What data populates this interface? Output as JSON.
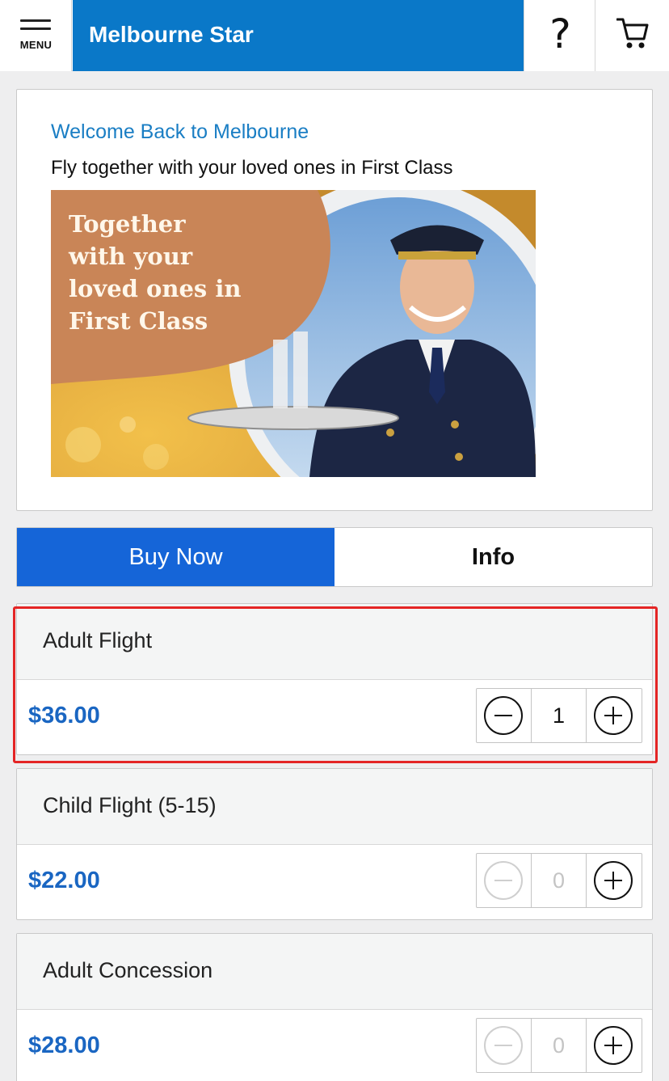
{
  "header": {
    "menu_label": "MENU",
    "title": "Melbourne Star",
    "help_label": "?",
    "icons": {
      "menu": "hamburger-icon",
      "help": "question-mark-icon",
      "cart": "cart-icon"
    }
  },
  "promo": {
    "welcome": "Welcome Back to Melbourne",
    "tagline": "Fly together with your loved ones in First Class",
    "banner_text": "Together with your loved ones in First Class"
  },
  "tabs": {
    "buy_now": "Buy Now",
    "info": "Info"
  },
  "tickets": [
    {
      "name": "Adult Flight",
      "price": "$36.00",
      "quantity": "1"
    },
    {
      "name": "Child Flight (5-15)",
      "price": "$22.00",
      "quantity": "0"
    },
    {
      "name": "Adult Concession",
      "price": "$28.00",
      "quantity": "0"
    }
  ],
  "colors": {
    "header_blue": "#0a78c8",
    "tab_active": "#1565d8",
    "price_blue": "#1a66c2",
    "highlight_red": "#e42525"
  }
}
